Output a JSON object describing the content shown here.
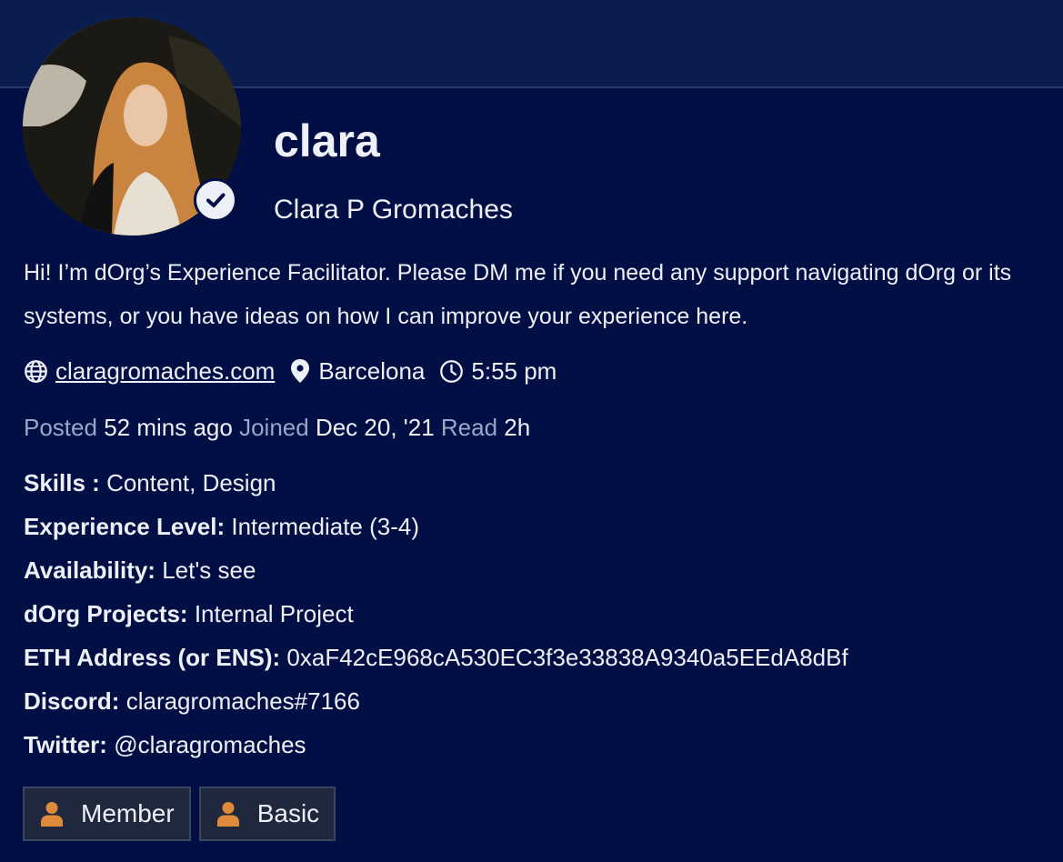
{
  "profile": {
    "username": "clara",
    "full_name": "Clara P Gromaches",
    "bio": "Hi! I’m dOrg’s Experience Facilitator. Please DM me if you need any support navigating dOrg or its systems, or you have ideas on how I can improve your experience here.",
    "verified": true
  },
  "meta": {
    "website": "claragromaches.com",
    "location": "Barcelona",
    "local_time": "5:55 pm"
  },
  "stats": {
    "posted_label": "Posted",
    "posted_value": "52 mins ago",
    "joined_label": "Joined",
    "joined_value": "Dec 20, '21",
    "read_label": "Read",
    "read_value": "2h"
  },
  "fields": [
    {
      "label": "Skills :",
      "value": "Content, Design"
    },
    {
      "label": "Experience Level:",
      "value": "Intermediate (3-4)"
    },
    {
      "label": "Availability:",
      "value": "Let's see"
    },
    {
      "label": "dOrg Projects:",
      "value": "Internal Project"
    },
    {
      "label": "ETH Address (or ENS):",
      "value": "0xaF42cE968cA530EC3f3e33838A9340a5EEdA8dBf"
    },
    {
      "label": "Discord:",
      "value": "claragromaches#7166"
    },
    {
      "label": "Twitter:",
      "value": "@claragromaches"
    }
  ],
  "badges": [
    {
      "label": "Member",
      "icon": "user-icon"
    },
    {
      "label": "Basic",
      "icon": "user-icon"
    }
  ],
  "colors": {
    "background": "#020f45",
    "header_band": "#0b1c4e",
    "muted_label": "#9aa6c8",
    "badge_icon": "#e08a3c",
    "badge_bg": "#20283e"
  }
}
